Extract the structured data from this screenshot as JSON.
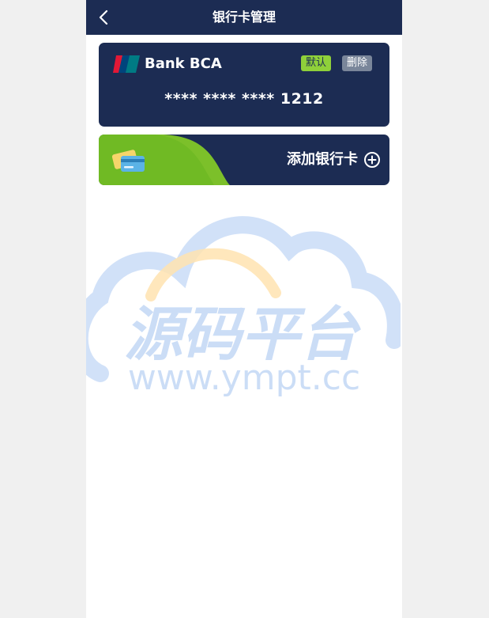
{
  "header": {
    "title": "银行卡管理",
    "back_icon": "chevron-left-icon"
  },
  "card": {
    "brand_icon": "unionpay-logo",
    "bank_name": "Bank BCA",
    "default_label": "默认",
    "delete_label": "删除",
    "number": "**** **** **** 1212"
  },
  "add_card": {
    "label": "添加银行卡",
    "icon": "plus-circle-icon"
  },
  "watermark": {
    "logo_text": "源码平台",
    "url": "www.ympt.cc"
  },
  "colors": {
    "navy": "#1c2c53",
    "green": "#7cc02a",
    "default_badge": "#8fd03a",
    "delete_badge": "#7a869a",
    "page_bg": "#f0f0f0"
  }
}
